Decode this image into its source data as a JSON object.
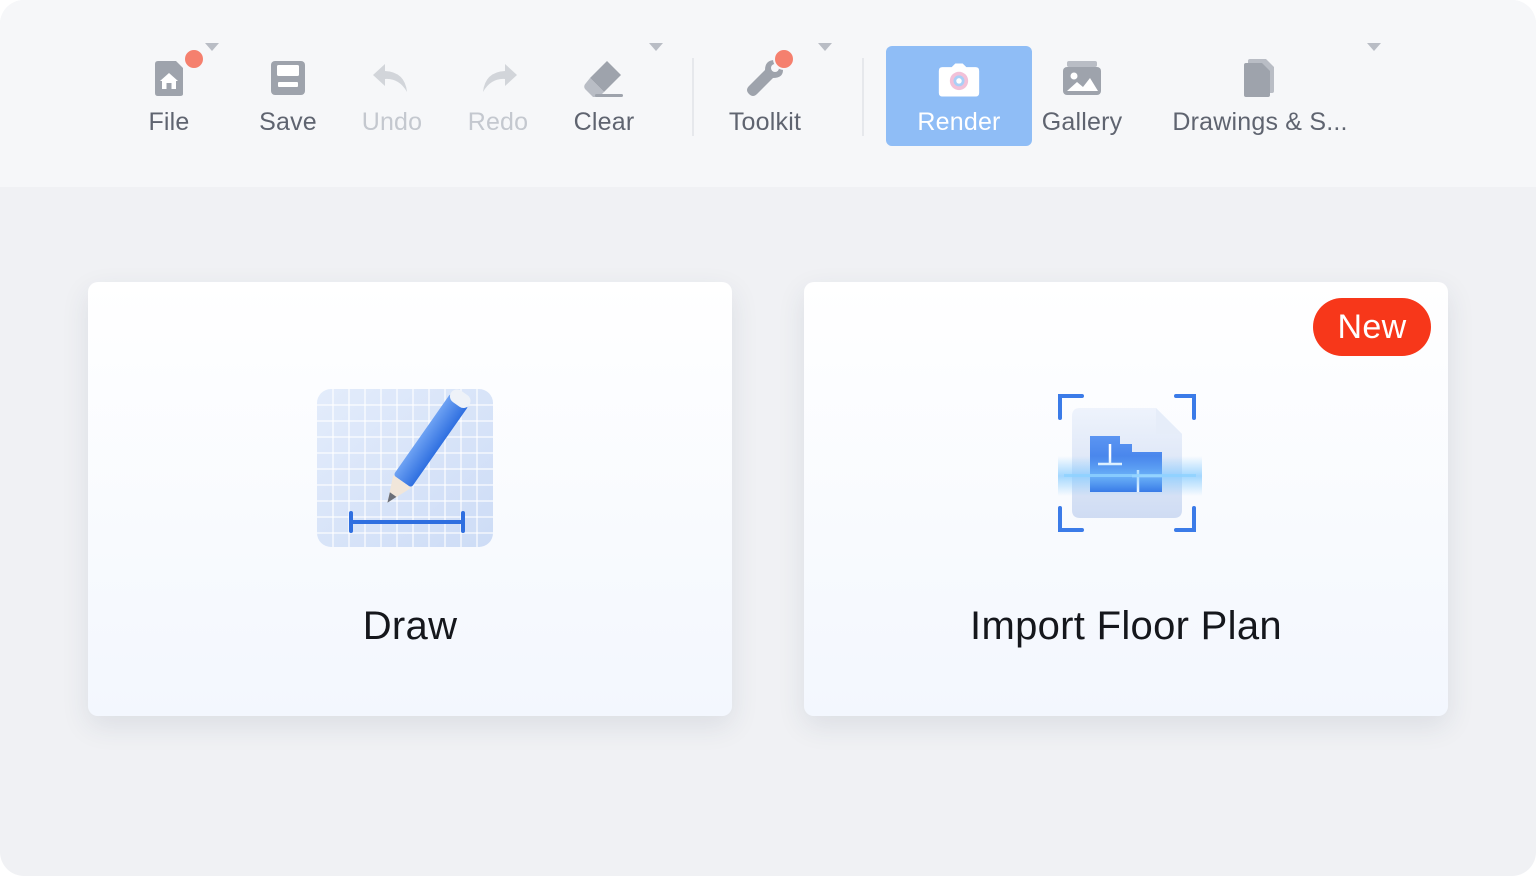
{
  "toolbar": {
    "items": [
      {
        "id": "file",
        "label": "File",
        "icon": "home-file-icon",
        "dropdown": true,
        "notification_dot": true,
        "enabled": true
      },
      {
        "id": "save",
        "label": "Save",
        "icon": "save-icon",
        "dropdown": false,
        "enabled": true
      },
      {
        "id": "undo",
        "label": "Undo",
        "icon": "undo-icon",
        "dropdown": false,
        "enabled": false
      },
      {
        "id": "redo",
        "label": "Redo",
        "icon": "redo-icon",
        "dropdown": false,
        "enabled": false
      },
      {
        "id": "clear",
        "label": "Clear",
        "icon": "eraser-icon",
        "dropdown": true,
        "enabled": true
      },
      {
        "id": "toolkit",
        "label": "Toolkit",
        "icon": "wrench-icon",
        "dropdown": true,
        "notification_dot": true,
        "enabled": true
      },
      {
        "id": "render",
        "label": "Render",
        "icon": "camera-icon",
        "dropdown": false,
        "active": true,
        "enabled": true
      },
      {
        "id": "gallery",
        "label": "Gallery",
        "icon": "image-icon",
        "dropdown": false,
        "enabled": true
      },
      {
        "id": "drawings",
        "label": "Drawings & S...",
        "icon": "documents-icon",
        "dropdown": true,
        "enabled": true
      }
    ]
  },
  "cards": [
    {
      "id": "draw",
      "title": "Draw",
      "icon": "pencil-grid-icon"
    },
    {
      "id": "import",
      "title": "Import Floor Plan",
      "icon": "scan-floor-plan-icon",
      "badge": "New"
    }
  ],
  "colors": {
    "background": "#f0f1f4",
    "toolbar": "#f6f7f9",
    "active_tool": "#8fbdf6",
    "badge": "#f7371a",
    "notification_dot": "#f5806e",
    "accent_blue": "#3b7be8"
  }
}
